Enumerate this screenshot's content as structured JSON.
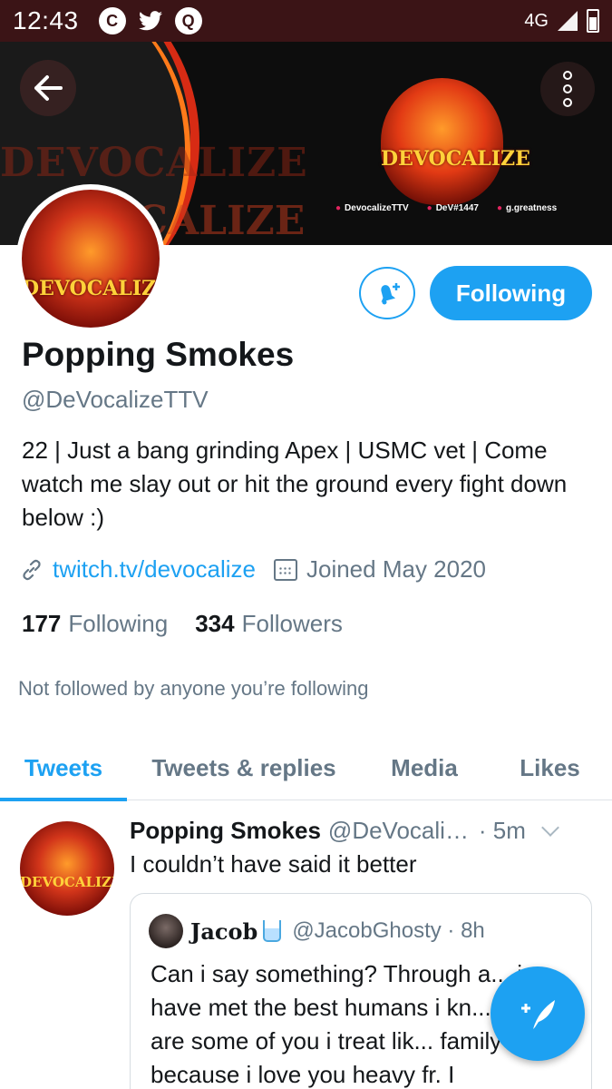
{
  "status_bar": {
    "time": "12:43",
    "network": "4G",
    "notification_icons": [
      "c-icon",
      "twitter-bird-icon",
      "q-icon"
    ]
  },
  "banner": {
    "logo_text": "DEVOCALIZE",
    "ghost_text_1": "DEVOCALIZE",
    "ghost_text_2": "CALIZE",
    "socials": [
      {
        "icon": "twitter-icon",
        "label": "DevocalizeTTV"
      },
      {
        "icon": "discord-icon",
        "label": "DeV#1447"
      },
      {
        "icon": "instagram-icon",
        "label": "g.greatness"
      }
    ]
  },
  "profile": {
    "avatar_text": "DEVOCALIZE",
    "follow_label": "Following",
    "name": "Popping Smokes",
    "handle": "@DeVocalizeTTV",
    "bio": "22 | Just a bang grinding Apex | USMC vet | Come watch me slay out or hit the ground every fight down below :)",
    "link": "twitch.tv/devocalize",
    "joined": "Joined May 2020",
    "following_count": "177",
    "following_label": "Following",
    "followers_count": "334",
    "followers_label": "Followers",
    "not_followed_text": "Not followed by anyone you’re following"
  },
  "tabs": [
    {
      "label": "Tweets",
      "active": true
    },
    {
      "label": "Tweets & replies",
      "active": false
    },
    {
      "label": "Media",
      "active": false
    },
    {
      "label": "Likes",
      "active": false
    }
  ],
  "tweet": {
    "avatar_text": "DEVOCALIZE",
    "name": "Popping Smokes",
    "handle": "@DeVocaliz...",
    "time": "· 5m",
    "text": "I couldn’t have said it better",
    "quote": {
      "name": "Jacob",
      "handle": "@JacobGhosty · 8h",
      "text": "Can i say something? Through a... i have met the best humans i kn... there are some of you i treat lik... family because i love you heavy fr. I"
    }
  },
  "colors": {
    "accent": "#1da1f2",
    "status_bar": "#3b1416",
    "secondary_text": "#657786"
  }
}
